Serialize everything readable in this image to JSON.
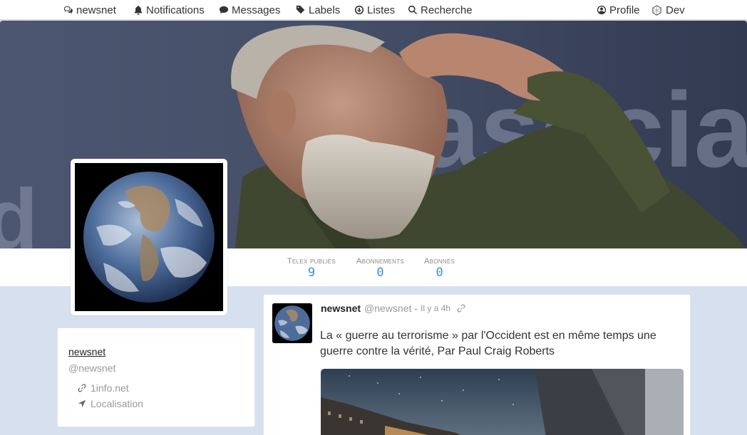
{
  "nav": {
    "brand": "newsnet",
    "notifications": "Notifications",
    "messages": "Messages",
    "labels": "Labels",
    "lists": "Listes",
    "search": "Recherche",
    "profile": "Profile",
    "dev": "Dev"
  },
  "stats": [
    {
      "label": "Telex publiés",
      "value": "9"
    },
    {
      "label": "Abonnements",
      "value": "0"
    },
    {
      "label": "Abonnés",
      "value": "0"
    }
  ],
  "profile": {
    "name": "newsnet",
    "handle": "@newsnet",
    "website": "1info.net",
    "location": "Localisation"
  },
  "post": {
    "author": "newsnet",
    "handle": "@newsnet",
    "separator": "-",
    "time": "Il y a 4h",
    "text": "La « guerre au terrorisme » par l'Occident est en même temps une guerre contre la vérité, Par Paul Craig Roberts"
  },
  "colors": {
    "page_bg": "#d6e0ef",
    "accent": "#3a8fd6",
    "card_bg": "#ffffff"
  },
  "icons": {
    "brand": "comments-icon",
    "notifications": "bell-icon",
    "messages": "comment-icon",
    "labels": "tags-icon",
    "lists": "list-circle-icon",
    "search": "search-icon",
    "profile": "user-circle-icon",
    "dev": "hexagon-icon",
    "website": "link-icon",
    "location": "location-arrow-icon"
  }
}
